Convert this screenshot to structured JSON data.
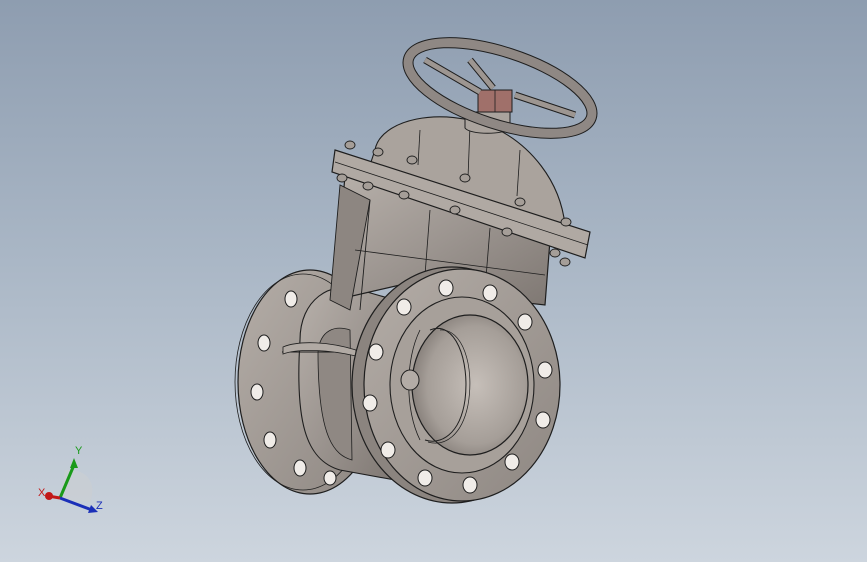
{
  "viewport": {
    "background_top": "#8e9db0",
    "background_bottom": "#cdd5de"
  },
  "model": {
    "body_color": "#9c9590",
    "flange_color": "#a39c96",
    "handwheel_color": "#8f8884",
    "stem_nut_color": "#a0706a",
    "edge_color": "#1e1e1e"
  },
  "triad": {
    "x_label": "X",
    "y_label": "Y",
    "z_label": "Z",
    "x_color": "#c21818",
    "y_color": "#1a9a1a",
    "z_color": "#1a2fb8"
  }
}
